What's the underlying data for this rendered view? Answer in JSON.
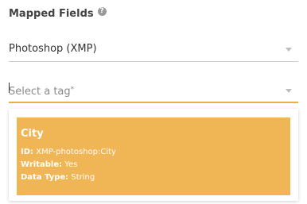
{
  "section": {
    "title": "Mapped Fields",
    "help_icon_symbol": "?"
  },
  "schema_select": {
    "value": "Photoshop (XMP)",
    "icon": "chevron-down-icon"
  },
  "tag_select": {
    "placeholder": "Select a tag",
    "required_marker": "*",
    "icon": "chevron-down-icon",
    "focused": true
  },
  "dropdown": {
    "options": [
      {
        "title": "City",
        "id_label": "ID:",
        "id_value": "XMP-photoshop:City",
        "writable_label": "Writable:",
        "writable_value": "Yes",
        "datatype_label": "Data Type:",
        "datatype_value": "String",
        "highlighted": true
      }
    ]
  },
  "colors": {
    "accent": "#f0b554",
    "focus_underline": "#e8b04c"
  }
}
